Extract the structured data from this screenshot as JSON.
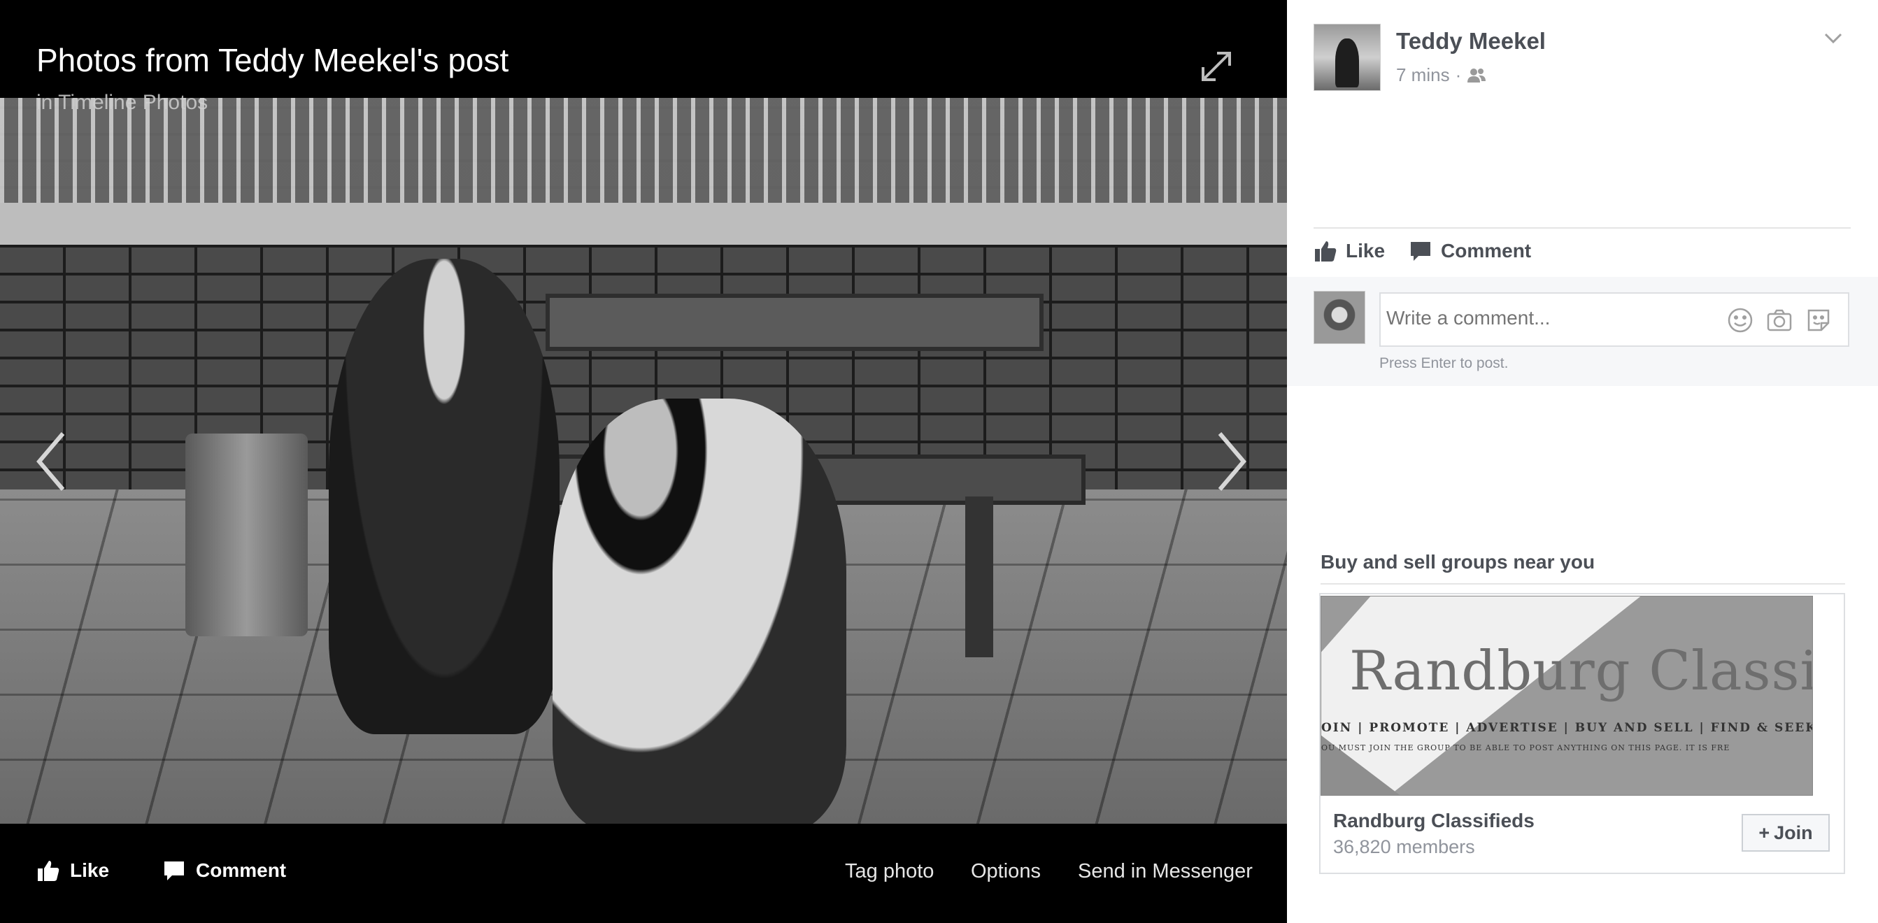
{
  "viewer": {
    "title": "Photos from Teddy Meekel's post",
    "subtitle": "in Timeline Photos",
    "actions": {
      "like_label": "Like",
      "comment_label": "Comment",
      "tag_label": "Tag photo",
      "options_label": "Options",
      "send_label": "Send in Messenger"
    }
  },
  "post": {
    "author": "Teddy Meekel",
    "time": "7 mins",
    "separator": "·",
    "like_label": "Like",
    "comment_label": "Comment",
    "comment_placeholder": "Write a comment...",
    "hint": "Press Enter to post."
  },
  "groups": {
    "title": "Buy and sell groups near you",
    "card": {
      "name": "Randburg Classifieds",
      "members": "36,820 members",
      "join_plus": "+",
      "join_label": "Join",
      "logo_text": "Randburg Classifieds",
      "logo_tagline": "OIN | PROMOTE | ADVERTISE | BUY AND SELL | FIND & SEEK JOB",
      "logo_fineprint": "OU MUST JOIN THE GROUP TO BE ABLE TO POST ANYTHING ON THIS PAGE. IT IS FRE"
    }
  },
  "icons": {
    "expand": "expand-icon",
    "prev": "chevron-left-icon",
    "next": "chevron-right-icon",
    "like": "thumbs-up-icon",
    "comment": "speech-bubble-icon",
    "audience": "friends-icon",
    "menu": "chevron-down-icon",
    "emoji": "emoji-icon",
    "camera": "camera-icon",
    "sticker": "sticker-icon"
  },
  "colors": {
    "viewer_bg": "#000000",
    "panel_text": "#4b4f56",
    "muted_text": "#90949c"
  }
}
